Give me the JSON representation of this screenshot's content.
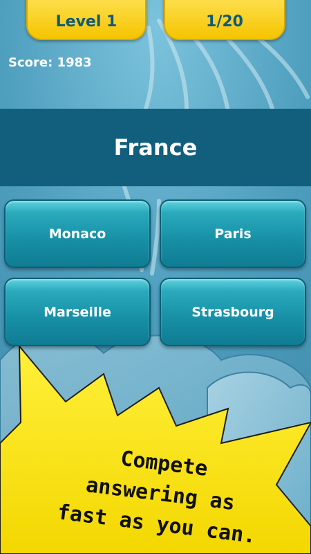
{
  "header": {
    "level_label": "Level 1",
    "progress_label": "1/20"
  },
  "score_label": "Score: 1983",
  "question": {
    "text": "France"
  },
  "answers": [
    "Monaco",
    "Paris",
    "Marseille",
    "Strasbourg"
  ],
  "promo": {
    "lines": [
      "Compete",
      "answering as",
      "fast as you can."
    ]
  },
  "colors": {
    "background": "#4f9fbf",
    "band": "#125e7d",
    "tab": "#f5c400",
    "burst": "#f7e21b",
    "button": "#178fa5"
  }
}
